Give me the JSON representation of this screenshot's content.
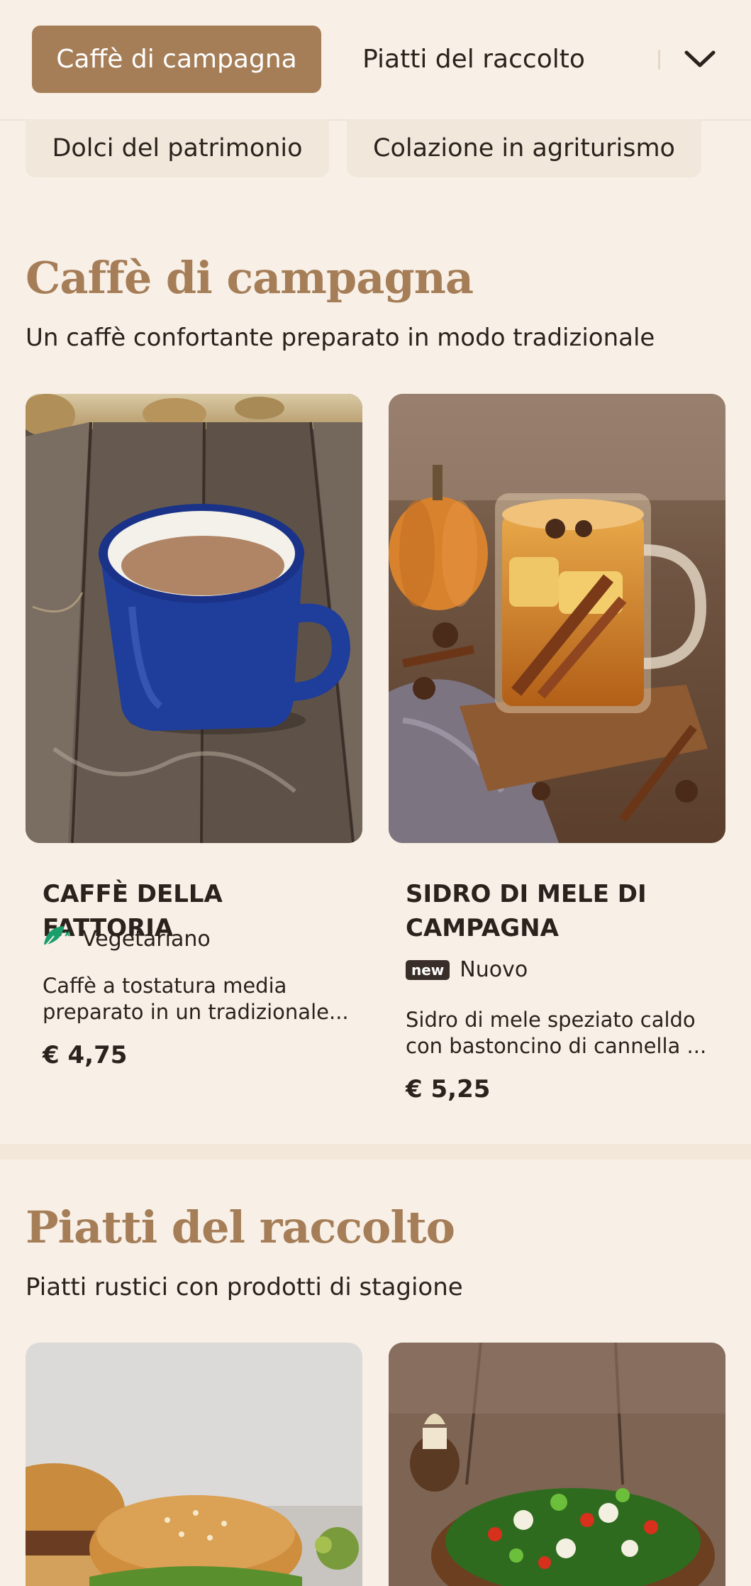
{
  "nav": {
    "tabs": [
      "Caffè di campagna",
      "Piatti del raccolto"
    ],
    "chips": [
      "Dolci del patrimonio",
      "Colazione in agriturismo"
    ],
    "active_color": "#a57e58"
  },
  "sections": [
    {
      "title": "Caffè di campagna",
      "subtitle": "Un caffè confortante preparato in modo tradizionale",
      "items": [
        {
          "name": "CAFFÈ DELLA FATTORIA",
          "badge_icon": "vegetarian-leaf-icon",
          "badge": "Vegetariano",
          "desc_line1": "Caffè a tostatura media",
          "desc_line2": "preparato in un tradizionale...",
          "price": "€ 4,75"
        },
        {
          "name_line1": "SIDRO DI MELE DI",
          "name_line2": "CAMPAGNA",
          "badge_icon_text": "new",
          "badge": "Nuovo",
          "desc_line1": "Sidro di mele speziato caldo",
          "desc_line2": "con bastoncino di cannella ...",
          "price": "€ 5,25"
        }
      ]
    },
    {
      "title": "Piatti del raccolto",
      "subtitle": "Piatti rustici con prodotti di stagione"
    }
  ]
}
